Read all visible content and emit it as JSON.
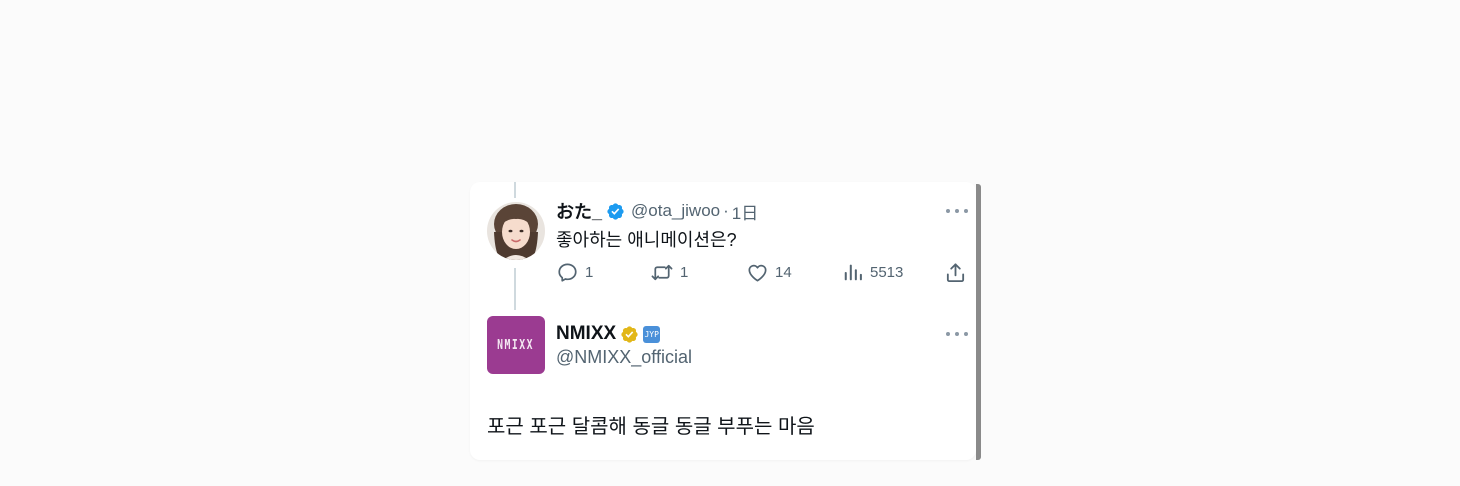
{
  "reply": {
    "display_name": "おた_",
    "handle": "@ota_jiwoo",
    "separator": "·",
    "time": "1日",
    "text": "좋아하는 애니메이션은?",
    "verified": true,
    "avatar_icon": "profile-photo",
    "metrics": {
      "replies": "1",
      "retweets": "1",
      "likes": "14",
      "views": "5513"
    }
  },
  "main": {
    "display_name": "NMIXX",
    "handle": "@NMIXX_official",
    "text": "포근 포근 달콤해 동글 동글 부푸는 마음",
    "verified_type": "gold",
    "affiliate_badge": "JYP",
    "avatar_text": "NMIXX"
  },
  "colors": {
    "verified_blue": "#1d9bf0",
    "verified_gold": "#e2b719",
    "brand_purple": "#9b3b91",
    "muted_text": "#536471"
  }
}
